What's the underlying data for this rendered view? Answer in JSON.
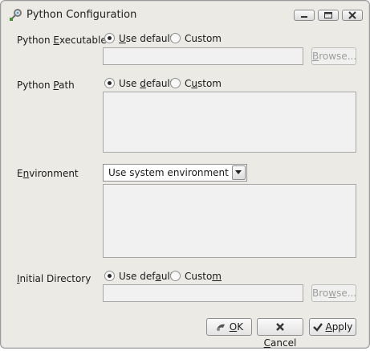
{
  "window": {
    "title": "Python Configuration",
    "icon": "python-config-icon"
  },
  "controls": {
    "minimize": "minimize-icon",
    "maximize": "maximize-icon",
    "close": "close-icon"
  },
  "python_executable": {
    "label_pre": "Python ",
    "label_key": "E",
    "label_post": "xecutable",
    "use_default_pre": "",
    "use_default_key": "U",
    "use_default_post": "se default",
    "custom": "Custom",
    "selected": "use_default",
    "path_value": "",
    "browse_pre": "",
    "browse_key": "B",
    "browse_post": "rowse..."
  },
  "python_path": {
    "label_pre": "Python ",
    "label_key": "P",
    "label_post": "ath",
    "use_default_pre": "Use ",
    "use_default_key": "d",
    "use_default_post": "efault",
    "custom_pre": "C",
    "custom_key": "u",
    "custom_post": "stom",
    "selected": "use_default",
    "value": ""
  },
  "environment": {
    "label_pre": "E",
    "label_key": "n",
    "label_post": "vironment",
    "selected_option": "Use system environment",
    "value": ""
  },
  "initial_directory": {
    "label_pre": "",
    "label_key": "I",
    "label_post": "nitial Directory",
    "use_default_pre": "Use def",
    "use_default_key": "a",
    "use_default_post": "ult",
    "custom_pre": "Custo",
    "custom_key": "m",
    "custom_post": "",
    "selected": "use_default",
    "path_value": "",
    "browse_pre": "Bro",
    "browse_key": "w",
    "browse_post": "se..."
  },
  "buttons": {
    "ok_pre": "",
    "ok_key": "O",
    "ok_post": "K",
    "cancel_pre": "",
    "cancel_key": "C",
    "cancel_post": "ancel",
    "apply_pre": "",
    "apply_key": "A",
    "apply_post": "pply"
  },
  "colors": {
    "background": "#eceae4",
    "field_disabled": "#f1f1f1",
    "border": "#a7a7a7"
  }
}
